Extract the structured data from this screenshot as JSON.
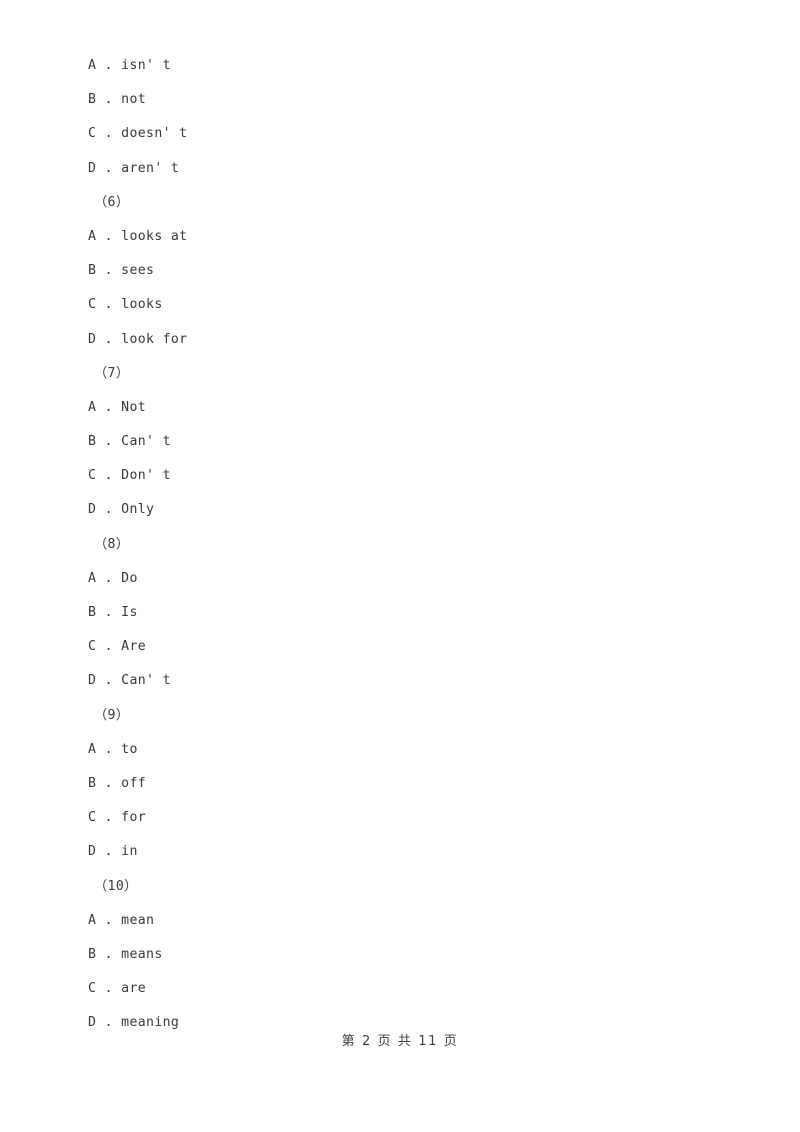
{
  "document": {
    "page_background": "#ffffff",
    "text_color": "#3a3a3a"
  },
  "blocks": [
    {
      "options": [
        {
          "text": "A . isn' t"
        },
        {
          "text": "B . not"
        },
        {
          "text": "C . doesn' t"
        },
        {
          "text": "D . aren' t"
        }
      ]
    },
    {
      "question_label": "（6）",
      "options": [
        {
          "text": "A . looks at"
        },
        {
          "text": "B . sees"
        },
        {
          "text": "C . looks"
        },
        {
          "text": "D . look for"
        }
      ]
    },
    {
      "question_label": "（7）",
      "options": [
        {
          "text": "A . Not"
        },
        {
          "text": "B . Can' t"
        },
        {
          "text": "C . Don' t"
        },
        {
          "text": "D . Only"
        }
      ]
    },
    {
      "question_label": "（8）",
      "options": [
        {
          "text": "A . Do"
        },
        {
          "text": "B . Is"
        },
        {
          "text": "C . Are"
        },
        {
          "text": "D . Can' t"
        }
      ]
    },
    {
      "question_label": "（9）",
      "options": [
        {
          "text": "A . to"
        },
        {
          "text": "B . off"
        },
        {
          "text": "C . for"
        },
        {
          "text": "D . in"
        }
      ]
    },
    {
      "question_label": "（10）",
      "options": [
        {
          "text": "A . mean"
        },
        {
          "text": "B . means"
        },
        {
          "text": "C . are"
        },
        {
          "text": "D . meaning"
        }
      ]
    }
  ],
  "lines": [
    {
      "kind": "option",
      "text": "A . isn' t"
    },
    {
      "kind": "option",
      "text": "B . not"
    },
    {
      "kind": "option",
      "text": "C . doesn' t"
    },
    {
      "kind": "option",
      "text": "D . aren' t"
    },
    {
      "kind": "qnum",
      "text": "（6）"
    },
    {
      "kind": "option",
      "text": "A . looks at"
    },
    {
      "kind": "option",
      "text": "B . sees"
    },
    {
      "kind": "option",
      "text": "C . looks"
    },
    {
      "kind": "option",
      "text": "D . look for"
    },
    {
      "kind": "qnum",
      "text": "（7）"
    },
    {
      "kind": "option",
      "text": "A . Not"
    },
    {
      "kind": "option",
      "text": "B . Can' t"
    },
    {
      "kind": "option",
      "text": "C . Don' t"
    },
    {
      "kind": "option",
      "text": "D . Only"
    },
    {
      "kind": "qnum",
      "text": "（8）"
    },
    {
      "kind": "option",
      "text": "A . Do"
    },
    {
      "kind": "option",
      "text": "B . Is"
    },
    {
      "kind": "option",
      "text": "C . Are"
    },
    {
      "kind": "option",
      "text": "D . Can' t"
    },
    {
      "kind": "qnum",
      "text": "（9）"
    },
    {
      "kind": "option",
      "text": "A . to"
    },
    {
      "kind": "option",
      "text": "B . off"
    },
    {
      "kind": "option",
      "text": "C . for"
    },
    {
      "kind": "option",
      "text": "D . in"
    },
    {
      "kind": "qnum",
      "text": "（10）"
    },
    {
      "kind": "option",
      "text": "A . mean"
    },
    {
      "kind": "option",
      "text": "B . means"
    },
    {
      "kind": "option",
      "text": "C . are"
    },
    {
      "kind": "option",
      "text": "D . meaning"
    }
  ],
  "footer": {
    "text": "第 2 页 共 11 页",
    "current_page": "2",
    "total_pages": "11"
  }
}
